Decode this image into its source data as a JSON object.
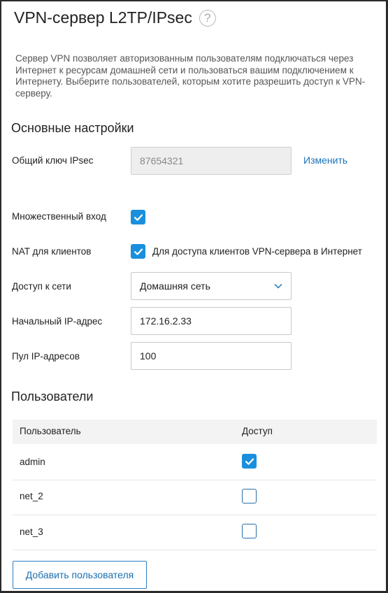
{
  "header": {
    "title": "VPN-сервер L2TP/IPsec",
    "help_glyph": "?"
  },
  "description": "Сервер VPN позволяет авторизованным пользователям подключаться через Интернет к ресурсам домашней сети и пользоваться вашим подключением к Интернету. Выберите пользователей, которым хотите разрешить доступ к VPN-серверу.",
  "basic": {
    "heading": "Основные настройки",
    "ipsec_key_label": "Общий ключ IPsec",
    "ipsec_key_value": "87654321",
    "change_link": "Изменить",
    "multi_login_label": "Множественный вход",
    "multi_login_checked": true,
    "nat_label": "NAT для клиентов",
    "nat_checked": true,
    "nat_checkbox_text": "Для доступа клиентов VPN-сервера в Интернет",
    "network_access_label": "Доступ к сети",
    "network_access_value": "Домашняя сеть",
    "start_ip_label": "Начальный IP-адрес",
    "start_ip_value": "172.16.2.33",
    "pool_label": "Пул IP-адресов",
    "pool_value": "100"
  },
  "users": {
    "heading": "Пользователи",
    "col_user": "Пользователь",
    "col_access": "Доступ",
    "rows": [
      {
        "name": "admin",
        "access": true
      },
      {
        "name": "net_2",
        "access": false
      },
      {
        "name": "net_3",
        "access": false
      }
    ],
    "add_button": "Добавить пользователя"
  },
  "colors": {
    "accent": "#1a8fdd",
    "link": "#1a73b8"
  }
}
